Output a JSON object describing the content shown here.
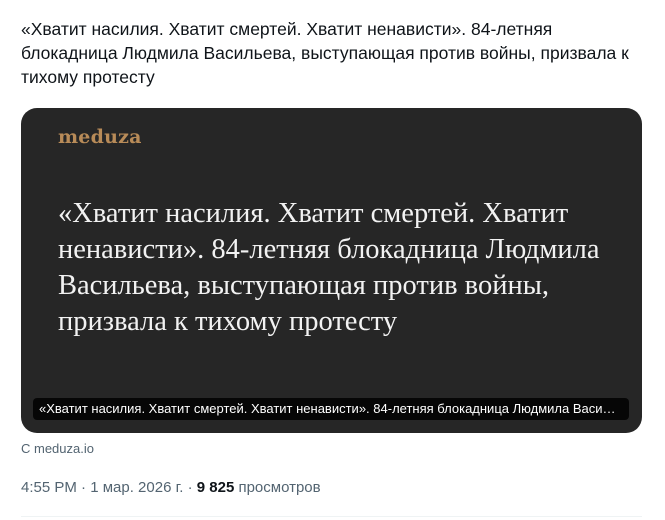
{
  "tweet": {
    "text": "«Хватит насилия. Хватит смертей. Хватит ненависти». 84-летняя блокадница Людмила Васильева, выступающая против войны, призвала к тихому протесту"
  },
  "card": {
    "logo": "meduza",
    "headline": "«Хватит насилия. Хватит смертей. Хватит ненависти». 84-летняя блокадница Людмила Васильева, выступающая против войны, призвала к тихому протесту",
    "caption": "«Хватит насилия. Хватит смертей. Хватит ненависти». 84-летняя блокадница Людмила Васильева, выступающая против войны, призвала к тихому протесту",
    "background_color": "#262626",
    "logo_color": "#b88b58"
  },
  "source": {
    "label": "С meduza.io"
  },
  "meta": {
    "time": "4:55 PM",
    "separator1": " · ",
    "date": "1 мар. 2026 г.",
    "separator2": " · ",
    "views_count": "9 825",
    "views_label": " просмотров"
  }
}
